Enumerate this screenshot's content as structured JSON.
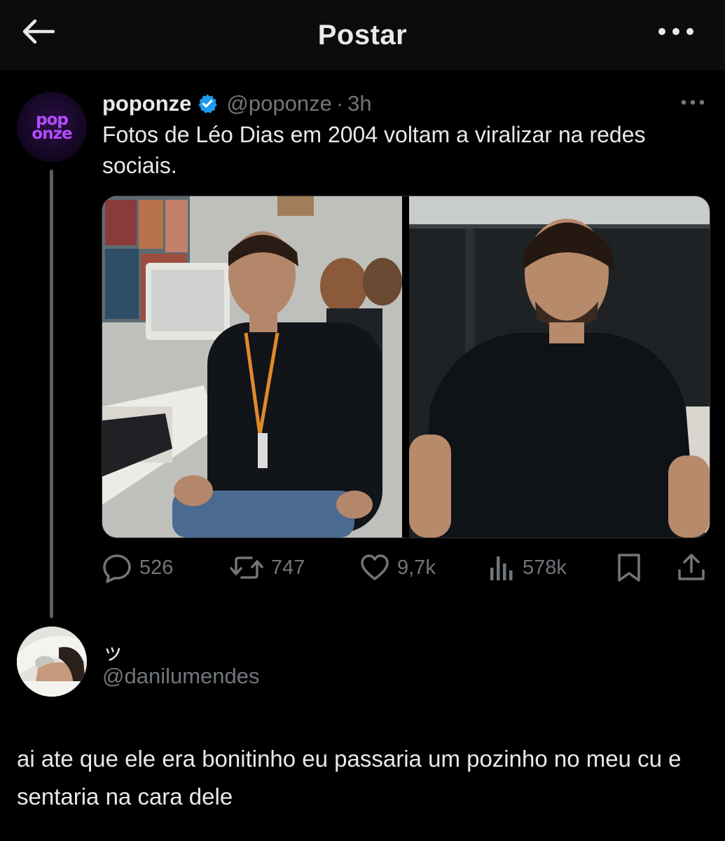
{
  "header": {
    "title": "Postar",
    "back_icon": "arrow-left-icon",
    "more_icon": "more-horizontal-icon"
  },
  "post": {
    "avatar_logo": {
      "line1": "pop",
      "line2": "onze"
    },
    "author_name": "poponze",
    "verified_icon": "verified-badge-icon",
    "verified_color": "#1d9bf0",
    "handle": "@poponze",
    "separator": "·",
    "time": "3h",
    "text": "Fotos de Léo Dias em 2004 voltam a viralizar na redes sociais.",
    "media": {
      "left_photo": "office-photo-left",
      "right_photo": "office-photo-right"
    },
    "actions": {
      "replies": "526",
      "reposts": "747",
      "likes": "9,7k",
      "views": "578k"
    }
  },
  "reply": {
    "display_name": "ッ",
    "handle": "@danilumendes",
    "text": "ai ate que ele era bonitinho eu passaria um pozinho no meu cu e sentaria na cara dele"
  }
}
